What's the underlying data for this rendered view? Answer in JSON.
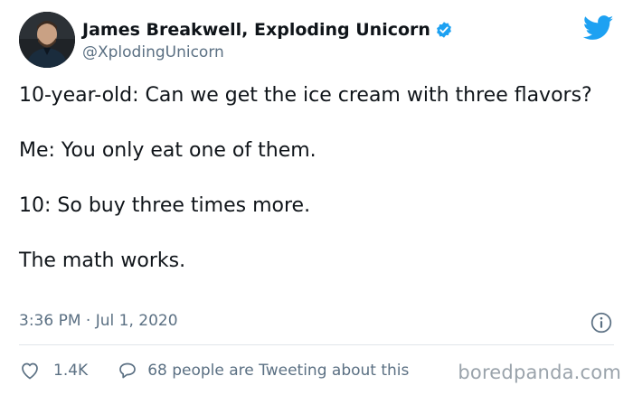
{
  "author": {
    "display_name": "James Breakwell, Exploding Unicorn",
    "handle": "@XplodingUnicorn",
    "verified": true
  },
  "tweet": {
    "lines": [
      "10-year-old: Can we get the ice cream with three flavors?",
      "Me: You only eat one of them.",
      "10: So buy three times more.",
      "The math works."
    ],
    "timestamp": "3:36 PM · Jul 1, 2020"
  },
  "actions": {
    "like_count": "1.4K",
    "reply_text": "68 people are Tweeting about this"
  },
  "watermark": "boredpanda.com",
  "icons": {
    "brand": "twitter-bird-icon",
    "verified": "verified-badge-icon",
    "info": "info-icon",
    "like": "heart-icon",
    "reply": "speech-bubble-icon"
  },
  "colors": {
    "twitter_blue": "#1da1f2",
    "secondary_text": "#5b7083",
    "primary_text": "#0f1419",
    "divider": "#e1e6ea"
  }
}
